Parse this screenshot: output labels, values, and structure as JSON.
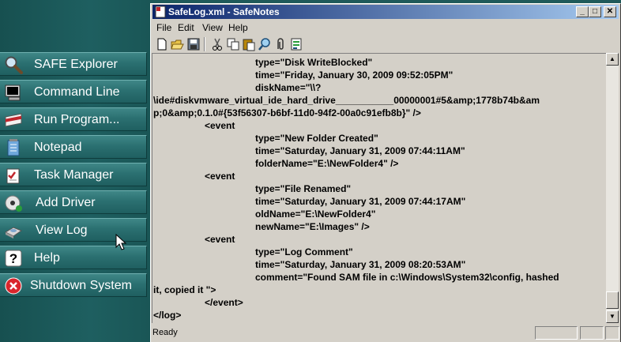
{
  "sidebar": {
    "items": [
      {
        "label": "SAFE Explorer",
        "icon": "magnifier-icon"
      },
      {
        "label": "Command Line",
        "icon": "monitor-icon"
      },
      {
        "label": "Run Program...",
        "icon": "run-icon"
      },
      {
        "label": "Notepad",
        "icon": "notepad-icon"
      },
      {
        "label": "Task Manager",
        "icon": "task-manager-icon"
      },
      {
        "label": "Add Driver",
        "icon": "cd-icon"
      },
      {
        "label": "View Log",
        "icon": "log-icon"
      },
      {
        "label": "Help",
        "icon": "help-icon"
      },
      {
        "label": "Shutdown System",
        "icon": "shutdown-icon"
      }
    ]
  },
  "window": {
    "title": "SafeLog.xml - SafeNotes",
    "buttons": {
      "minimize": "_",
      "maximize": "□",
      "close": "✕"
    }
  },
  "menu": {
    "file": "File",
    "edit": "Edit",
    "view": "View",
    "help": "Help"
  },
  "toolbar": {
    "icons": [
      "new-icon",
      "open-icon",
      "save-icon",
      "cut-icon",
      "copy-icon",
      "paste-icon",
      "find-icon",
      "attach-icon",
      "export-icon"
    ]
  },
  "document": {
    "lines": [
      "type=\"Disk WriteBlocked\"",
      "time=\"Friday, January 30, 2009 09:52:05PM\"",
      "diskName=\"\\\\?",
      "\\ide#diskvmware_virtual_ide_hard_drive___________00000001#5&amp;1778b74b&am",
      "p;0&amp;0.1.0#{53f56307-b6bf-11d0-94f2-00a0c91efb8b}\" />",
      "<event",
      "type=\"New Folder Created\"",
      "time=\"Saturday, January 31, 2009 07:44:11AM\"",
      "folderName=\"E:\\NewFolder4\" />",
      "<event",
      "type=\"File Renamed\"",
      "time=\"Saturday, January 31, 2009 07:44:17AM\"",
      "oldName=\"E:\\NewFolder4\"",
      "newName=\"E:\\Images\" />",
      "<event",
      "type=\"Log Comment\"",
      "time=\"Saturday, January 31, 2009 08:20:53AM\"",
      "comment=\"Found SAM file in c:\\Windows\\System32\\config, hashed",
      "it, copied it \">",
      "</event>",
      "</log>"
    ]
  },
  "status": {
    "text": "Ready"
  },
  "colors": {
    "titlebar_start": "#0a246a",
    "titlebar_end": "#a6caf0",
    "sidebar_bg": "#1f5a5a",
    "window_bg": "#d4d0c8"
  }
}
